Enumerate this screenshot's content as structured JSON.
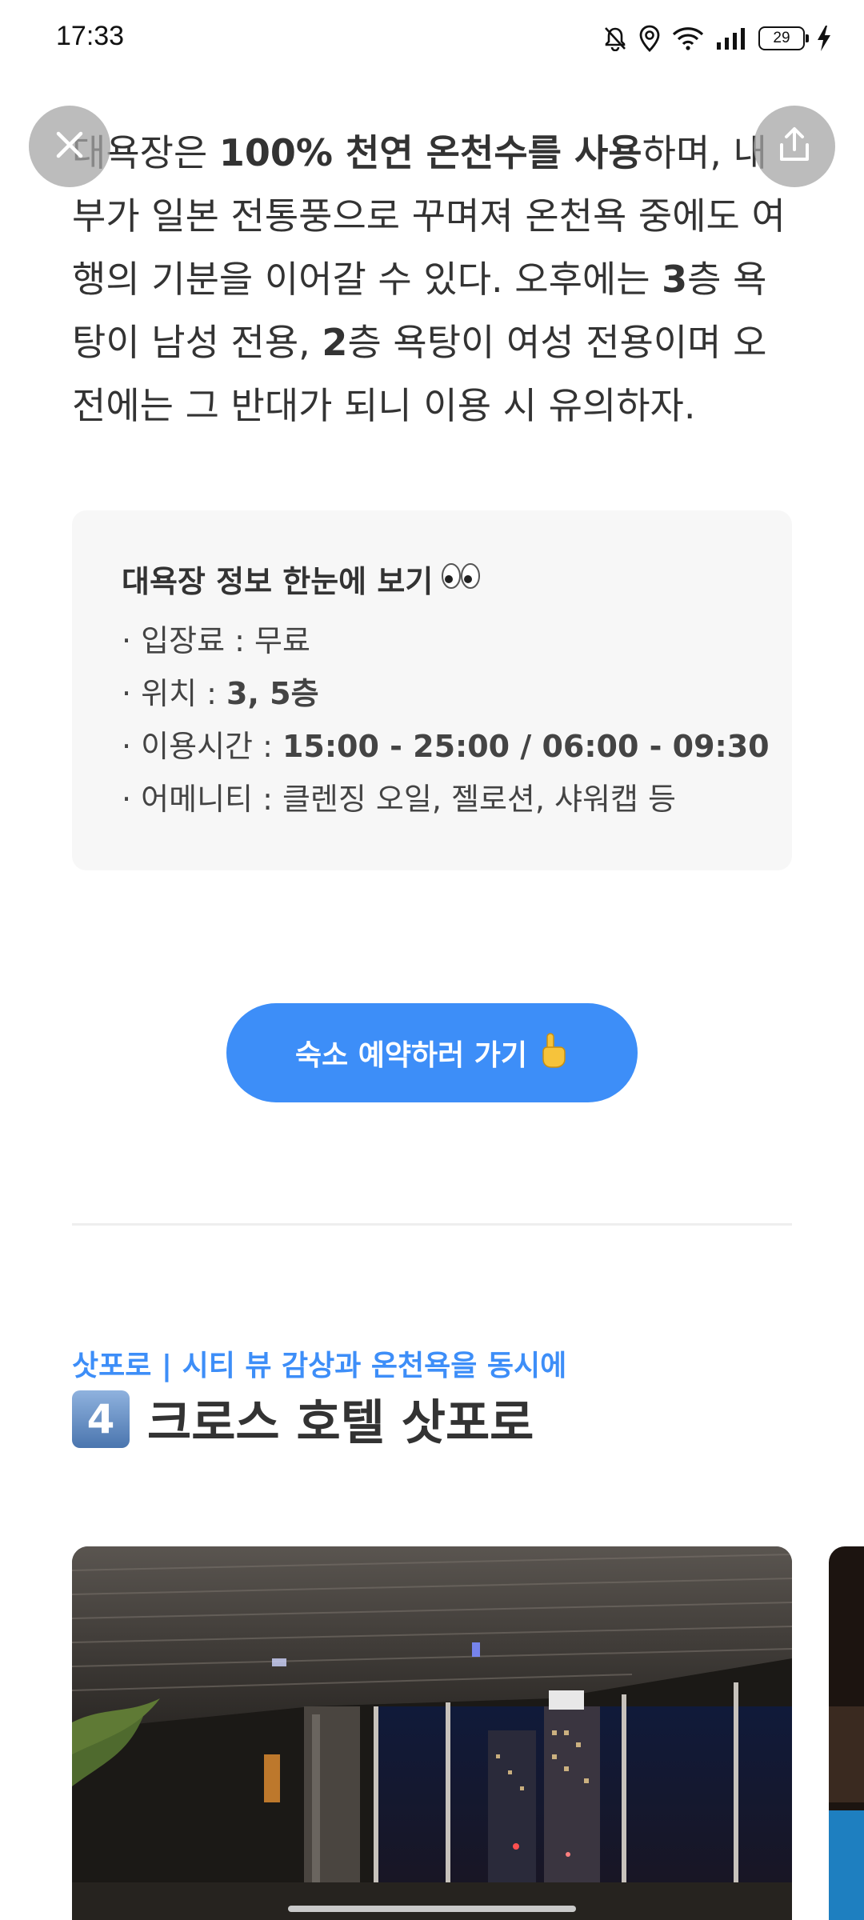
{
  "status_bar": {
    "time": "17:33",
    "battery": "29",
    "icons": [
      "mute-bell-icon",
      "location-icon",
      "wifi-icon",
      "signal-icon",
      "battery-icon",
      "charging-bolt-icon"
    ]
  },
  "overlay": {
    "close_icon": "close-icon",
    "share_icon": "share-icon"
  },
  "article": {
    "p1_a": "대욕장은 ",
    "p1_bold": "100% 천연 온천수를 사용",
    "p1_b": "하며, 내부가 일본 전통풍으로 꾸며져 온천욕 중에도 여행의 기분을 이어갈 수 있다. 오후에는 ",
    "p1_bold2": "3",
    "p1_c": "층 욕탕이 남성 전용, ",
    "p1_bold3": "2",
    "p1_d": "층 욕탕이 여성 전용이며 오전에는 그 반대가 되니 이용 시 유의하자."
  },
  "info_box": {
    "title": "대욕장 정보 한눈에 보기",
    "title_emoji": "eyes-icon",
    "items": [
      {
        "label": "· 입장료 : ",
        "value": "무료"
      },
      {
        "label": "· 위치 : ",
        "value": "3, 5층"
      },
      {
        "label": "· 이용시간 : ",
        "value": "15:00 - 25:00 / 06:00 - 09:30"
      },
      {
        "label": "· 어메니티 : ",
        "value": "클렌징 오일, 젤로션, 샤워캡 등"
      }
    ]
  },
  "cta": {
    "label": "숙소 예약하러 가기",
    "icon": "pointing-hand-icon"
  },
  "section": {
    "subtitle": "삿포로 | 시티 뷰 감상과 온천욕을 동시에",
    "number": "4",
    "title": "크로스 호텔 삿포로"
  },
  "colors": {
    "accent": "#3d8ef8",
    "text": "#333333",
    "info_bg": "#f7f7f7"
  }
}
